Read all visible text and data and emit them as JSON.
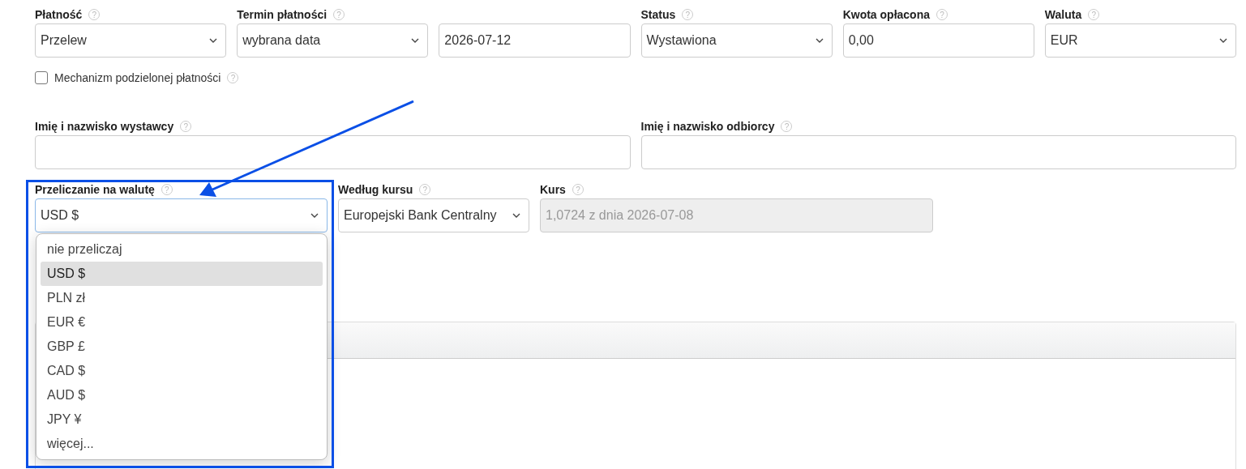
{
  "payment_row": [
    {
      "label": "Płatność",
      "help": "?",
      "kind": "select",
      "value": "Przelew"
    },
    {
      "label": "Termin płatności",
      "help": "?",
      "kind": "select",
      "value": "wybrana data"
    },
    {
      "kind": "input",
      "value": "2026-07-12"
    },
    {
      "label": "Status",
      "help": "?",
      "kind": "select",
      "value": "Wystawiona"
    },
    {
      "label": "Kwota opłacona",
      "help": "?",
      "kind": "input",
      "value": "0,00"
    },
    {
      "label": "Waluta",
      "help": "?",
      "kind": "select",
      "value": "EUR"
    }
  ],
  "split_payment": {
    "label": "Mechanizm podzielonej płatności",
    "help": "?",
    "checked": false
  },
  "names_row": [
    {
      "label": "Imię i nazwisko wystawcy",
      "help": "?",
      "kind": "input"
    },
    {
      "label": "Imię i nazwisko odbiorcy",
      "help": "?",
      "kind": "input"
    }
  ],
  "conversion_row": [
    {
      "label": "Przeliczanie na walutę",
      "help": "?",
      "kind": "select",
      "value": "USD $",
      "expanded": true,
      "disabled": false,
      "options": [
        {
          "label": "nie przeliczaj",
          "selected": false
        },
        {
          "label": "USD $",
          "selected": true
        },
        {
          "label": "PLN zł",
          "selected": false
        },
        {
          "label": "EUR €",
          "selected": false
        },
        {
          "label": "GBP £",
          "selected": false
        },
        {
          "label": "CAD $",
          "selected": false
        },
        {
          "label": "AUD $",
          "selected": false
        },
        {
          "label": "JPY ¥",
          "selected": false
        },
        {
          "label": "więcej...",
          "selected": false
        }
      ]
    },
    {
      "label": "Według kursu",
      "help": "?",
      "kind": "select",
      "value": "Europejski Bank Centralny",
      "expanded": false,
      "disabled": false
    },
    {
      "label": "Kurs",
      "help": "?",
      "kind": "input",
      "value": "1,0724 z dnia 2026-07-08",
      "disabled": true
    }
  ],
  "panel": {
    "kind": "card"
  },
  "overlay": {
    "kind": "arrow-and-frame"
  }
}
